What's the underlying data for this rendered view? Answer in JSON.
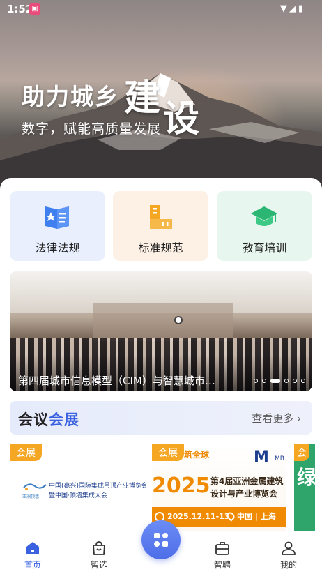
{
  "status_bar": {
    "time": "1:52",
    "icons": [
      "wifi-icon",
      "signal-icon",
      "battery-icon"
    ]
  },
  "hero": {
    "title_small": "助力城乡",
    "title_big_1": "建",
    "title_big_2": "设",
    "subtitle": "数字，赋能高质量发展"
  },
  "categories": [
    {
      "label": "法律法规",
      "icon": "law-book-icon",
      "bg": "#e9effd"
    },
    {
      "label": "标准规范",
      "icon": "standard-ruler-icon",
      "bg": "#fdf1e6"
    },
    {
      "label": "教育培训",
      "icon": "graduation-cap-icon",
      "bg": "#e7f6ef"
    }
  ],
  "banner": {
    "caption": "第四届城市信息模型（CIM）与智慧城市…",
    "slide_count": 6,
    "active_slide": 3
  },
  "section": {
    "title_part1": "会议",
    "title_part2": "会展",
    "more_label": "查看更多"
  },
  "expos": [
    {
      "tag": "会展",
      "line1": "中国(嘉兴)国际集成吊顶产业博览会",
      "line2": "暨中国·顶墙集成大会",
      "logo_text": "亚洲顶墙"
    },
    {
      "tag": "会展",
      "top_text": "筑全球",
      "year": "2025",
      "name_line1": "第4届亚洲金属建筑",
      "name_line2": "设计与产业博览会",
      "logo": "M",
      "logo_sub": "MB",
      "date": "2025.12.11-13",
      "place": "中国 | 上海"
    },
    {
      "tag": "会",
      "glyph": "绿"
    }
  ],
  "nav": {
    "items": [
      {
        "label": "首页",
        "icon": "home-icon",
        "active": true
      },
      {
        "label": "智选",
        "icon": "shopping-bag-icon",
        "active": false
      },
      {
        "label": "智聘",
        "icon": "briefcase-icon",
        "active": false
      },
      {
        "label": "我的",
        "icon": "user-icon",
        "active": false
      }
    ],
    "center_icon": "apps-grid-icon"
  },
  "colors": {
    "accent": "#3a61e0",
    "tag_orange": "#f5a623"
  }
}
